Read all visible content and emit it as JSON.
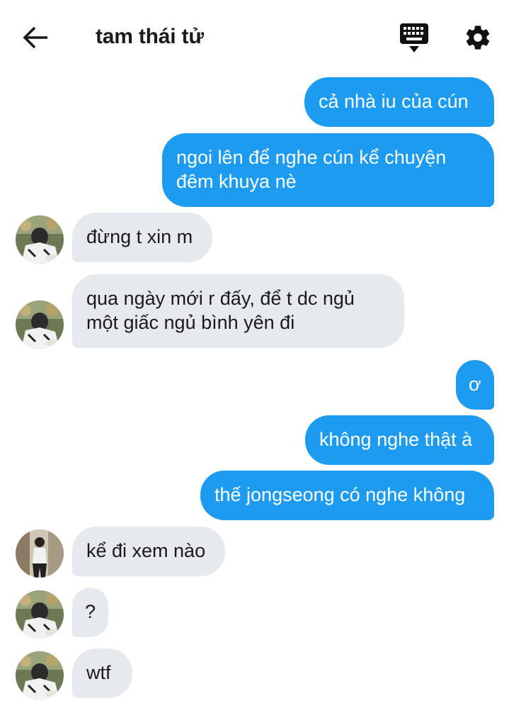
{
  "header": {
    "title": "tam thái tử",
    "back_icon": "arrow-left-icon",
    "keyboard_icon": "keyboard-icon",
    "settings_icon": "gear-icon"
  },
  "colors": {
    "outgoing_bubble": "#1d9bf0",
    "incoming_bubble": "#e6eaee",
    "text_dark": "#1a1a1a"
  },
  "messages": [
    {
      "direction": "out",
      "text": "cả nhà iu của cún"
    },
    {
      "direction": "out",
      "text": "ngoi lên để nghe cún kể chuyện\nđêm khuya nè"
    },
    {
      "direction": "in",
      "text": "đừng t xin m"
    },
    {
      "direction": "in",
      "text": "qua ngày mới r đấy, để t dc ngủ\nmột giấc ngủ bình yên đi"
    },
    {
      "direction": "out",
      "text": "ơ"
    },
    {
      "direction": "out",
      "text": "không nghe thật à"
    },
    {
      "direction": "out",
      "text": "thế jongseong có nghe không"
    },
    {
      "direction": "in",
      "text": "kể đi xem nào"
    },
    {
      "direction": "in",
      "text": "?"
    },
    {
      "direction": "in",
      "text": "wtf"
    }
  ]
}
